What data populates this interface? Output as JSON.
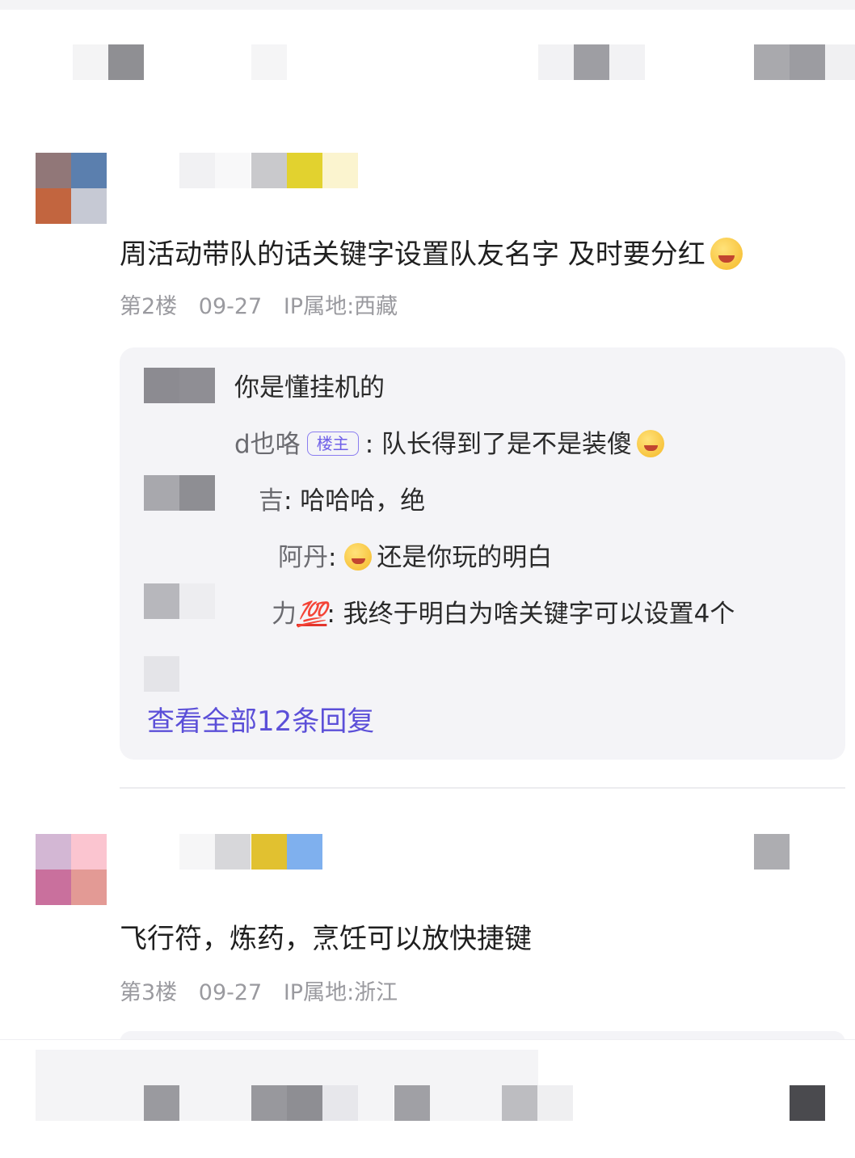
{
  "comments": [
    {
      "text": "周活动带队的话关键字设置队友名字 及时要分红",
      "emoji": "laughing-emoji",
      "floor": "第2楼",
      "date": "09-27",
      "ip": "IP属地:西藏",
      "replies": [
        {
          "name": "",
          "text": "你是懂挂机的"
        },
        {
          "name": "d也咯",
          "badge": "楼主",
          "text": ": 队长得到了是不是装傻",
          "emoji": "hand-over-mouth-emoji"
        },
        {
          "name": "吉",
          "text": ": 哈哈哈，绝"
        },
        {
          "name": "阿丹",
          "text": ": ",
          "emoji": "laughing-emoji",
          "after": "还是你玩的明白"
        },
        {
          "name": "力",
          "badge_icon": "💯",
          "text": ": 我终于明白为啥关键字可以设置4个"
        }
      ],
      "view_all": "查看全部12条回复"
    },
    {
      "text": "飞行符，炼药，烹饪可以放快捷键",
      "floor": "第3楼",
      "date": "09-27",
      "ip": "IP属地:浙江"
    }
  ],
  "colors": {
    "accent": "#5b4fd8",
    "meta": "#9a9a9f",
    "reply_bg": "#f4f4f7"
  }
}
